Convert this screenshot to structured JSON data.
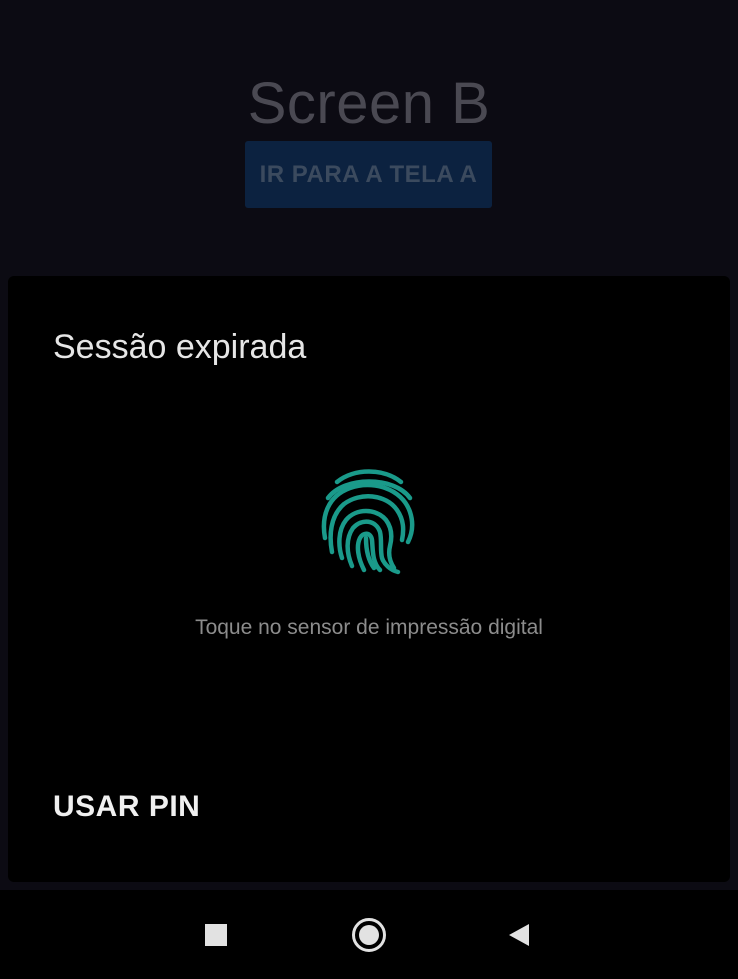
{
  "background_app": {
    "title": "Screen B",
    "button_label": "IR PARA A TELA A"
  },
  "dialog": {
    "title": "Sessão expirada",
    "fingerprint_icon": "fingerprint-icon",
    "hint": "Toque no sensor de impressão digital",
    "use_pin_label": "USAR PIN"
  },
  "navbar": {
    "recent_icon": "recent-apps-icon",
    "home_icon": "home-icon",
    "back_icon": "back-icon"
  },
  "colors": {
    "accent": "#1a9a8a",
    "dialog_bg": "#000000",
    "scrim_bg": "#0c0b13"
  }
}
